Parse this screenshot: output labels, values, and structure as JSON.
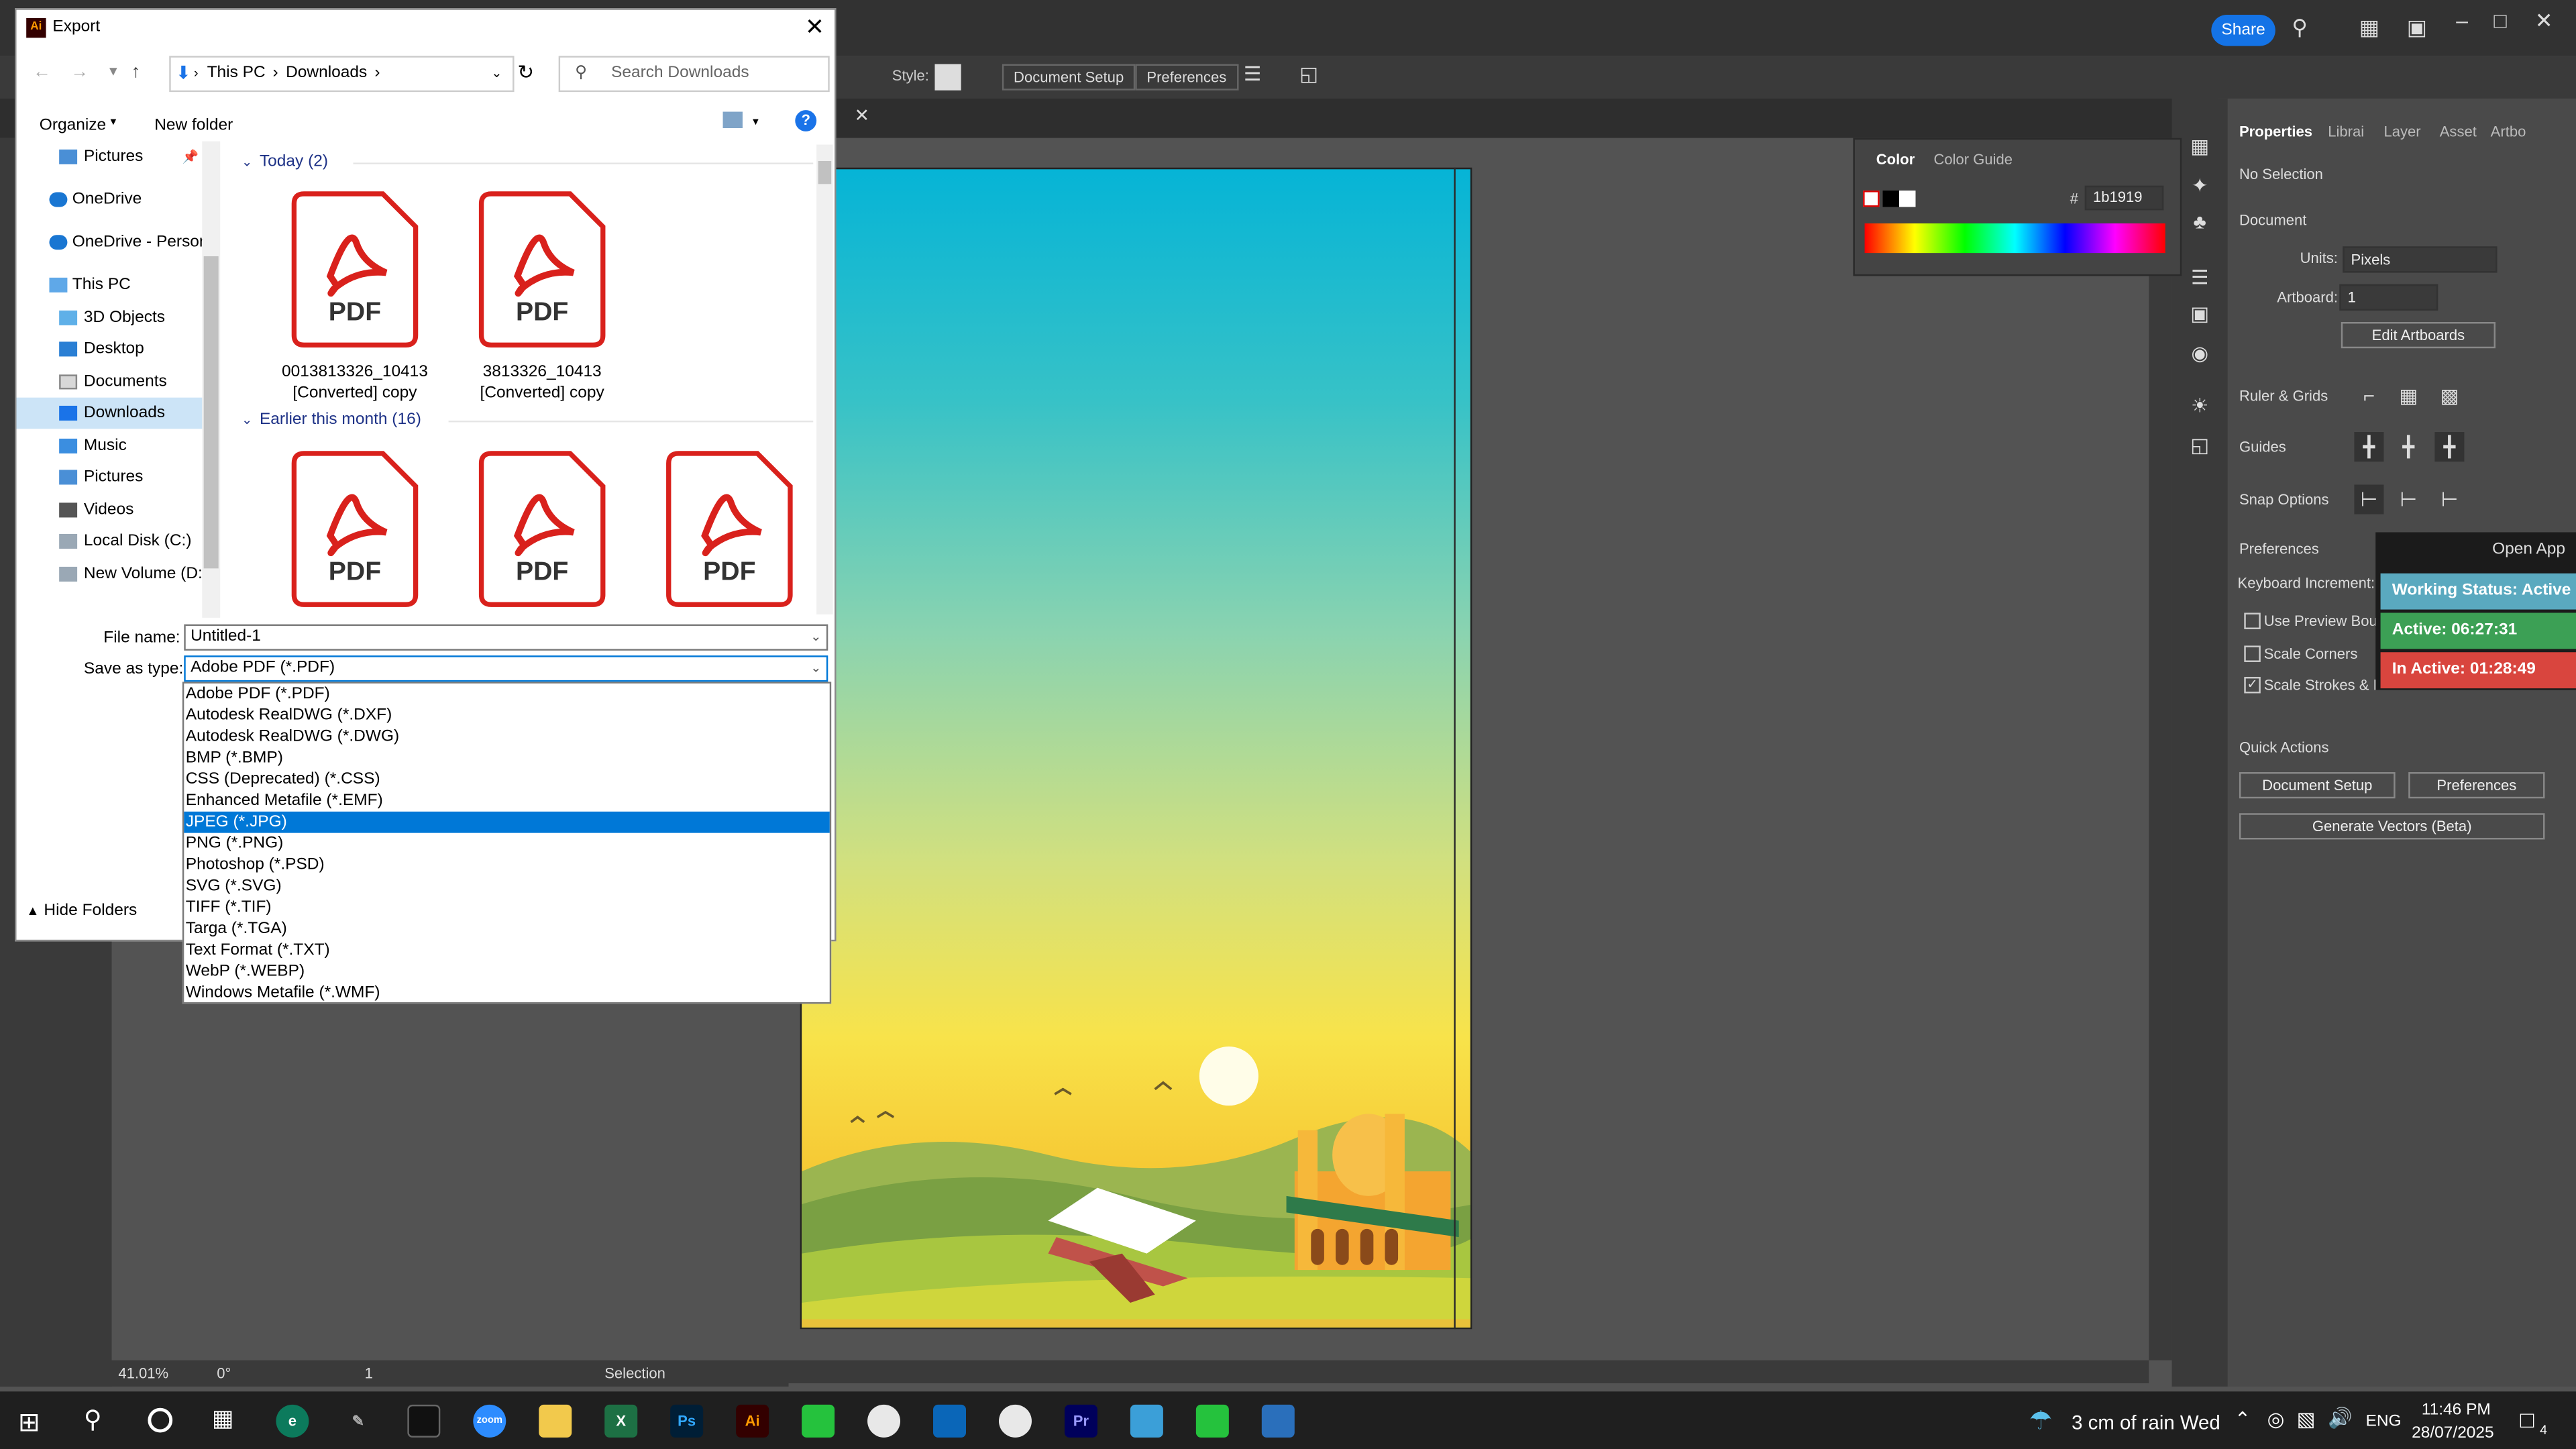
{
  "app": {
    "share_label": "Share",
    "control_bar": {
      "style_label": "Style:",
      "document_setup": "Document Setup",
      "preferences": "Preferences"
    },
    "status": {
      "zoom": "41.01%",
      "rotation": "0°",
      "artboard": "1",
      "tool": "Selection"
    }
  },
  "color_panel": {
    "tabs": [
      "Color",
      "Color Guide"
    ],
    "hash": "#",
    "hex_value": "1b1919"
  },
  "properties": {
    "tabs": [
      "Properties",
      "Librai",
      "Layer",
      "Asset",
      "Artbo"
    ],
    "no_selection": "No Selection",
    "document": "Document",
    "units_label": "Units:",
    "units_value": "Pixels",
    "artboard_label": "Artboard:",
    "artboard_value": "1",
    "edit_artboards": "Edit Artboards",
    "ruler_grids": "Ruler & Grids",
    "guides": "Guides",
    "snap_options": "Snap Options",
    "preferences": "Preferences",
    "keyboard_increment": "Keyboard Increment:",
    "use_preview_bounds": "Use Preview Bounc",
    "scale_corners": "Scale Corners",
    "scale_strokes": "Scale Strokes & Ef",
    "quick_actions": "Quick Actions",
    "qa_document_setup": "Document Setup",
    "qa_preferences": "Preferences",
    "generate_vectors": "Generate Vectors (Beta)"
  },
  "overlay": {
    "open_app": "Open App",
    "working_status": "Working Status: Active",
    "active": "Active: 06:27:31",
    "inactive": "In Active: 01:28:49",
    "colors": {
      "working": "#5aa9bf",
      "active": "#3ca055",
      "inactive": "#d9453e"
    }
  },
  "dialog": {
    "title": "Export",
    "breadcrumb": [
      "This PC",
      "Downloads"
    ],
    "search_placeholder": "Search Downloads",
    "organize": "Organize",
    "new_folder": "New folder",
    "nav_items": [
      {
        "label": "Pictures",
        "icon": "pictures-icon"
      },
      {
        "label": "OneDrive",
        "icon": "cloud-icon"
      },
      {
        "label": "OneDrive - Person",
        "icon": "cloud-icon"
      },
      {
        "label": "This PC",
        "icon": "pc-icon"
      },
      {
        "label": "3D Objects",
        "icon": "cube-icon"
      },
      {
        "label": "Desktop",
        "icon": "desktop-icon"
      },
      {
        "label": "Documents",
        "icon": "document-icon"
      },
      {
        "label": "Downloads",
        "icon": "download-icon"
      },
      {
        "label": "Music",
        "icon": "music-icon"
      },
      {
        "label": "Pictures",
        "icon": "pictures-icon"
      },
      {
        "label": "Videos",
        "icon": "video-icon"
      },
      {
        "label": "Local Disk (C:)",
        "icon": "disk-icon"
      },
      {
        "label": "New Volume (D:)",
        "icon": "disk-icon"
      }
    ],
    "groups": [
      {
        "label": "Today (2)"
      },
      {
        "label": "Earlier this month (16)"
      }
    ],
    "files": [
      {
        "name_line1": "0013813326_10413",
        "name_line2": "[Converted] copy",
        "icon_text": "PDF"
      },
      {
        "name_line1": "3813326_10413",
        "name_line2": "[Converted] copy",
        "icon_text": "PDF"
      }
    ],
    "pdf_text": "PDF",
    "file_name_label": "File name:",
    "file_name_value": "Untitled-1",
    "save_type_label": "Save as type:",
    "save_type_value": "Adobe PDF (*.PDF)",
    "hide_folders": "Hide Folders",
    "type_options": [
      "Adobe PDF (*.PDF)",
      "Autodesk RealDWG (*.DXF)",
      "Autodesk RealDWG (*.DWG)",
      "BMP (*.BMP)",
      "CSS (Deprecated) (*.CSS)",
      "Enhanced Metafile (*.EMF)",
      "JPEG (*.JPG)",
      "PNG (*.PNG)",
      "Photoshop (*.PSD)",
      "SVG (*.SVG)",
      "TIFF (*.TIF)",
      "Targa (*.TGA)",
      "Text Format (*.TXT)",
      "WebP (*.WEBP)",
      "Windows Metafile (*.WMF)"
    ],
    "selected_option": "JPEG (*.JPG)"
  },
  "taskbar": {
    "weather": "3 cm of rain Wed",
    "lang": "ENG",
    "time": "11:46 PM",
    "date": "28/07/2025",
    "notifications": "4",
    "apps": [
      {
        "name": "zoom-icon",
        "label": "zoom",
        "color": "#2d8cff"
      },
      {
        "name": "excel-icon",
        "label": "X",
        "color": "#1d7044"
      },
      {
        "name": "photoshop-icon",
        "label": "Ps",
        "color": "#001e36"
      },
      {
        "name": "illustrator-icon",
        "label": "Ai",
        "color": "#330000"
      },
      {
        "name": "premiere-icon",
        "label": "Pr",
        "color": "#00005b"
      }
    ]
  }
}
